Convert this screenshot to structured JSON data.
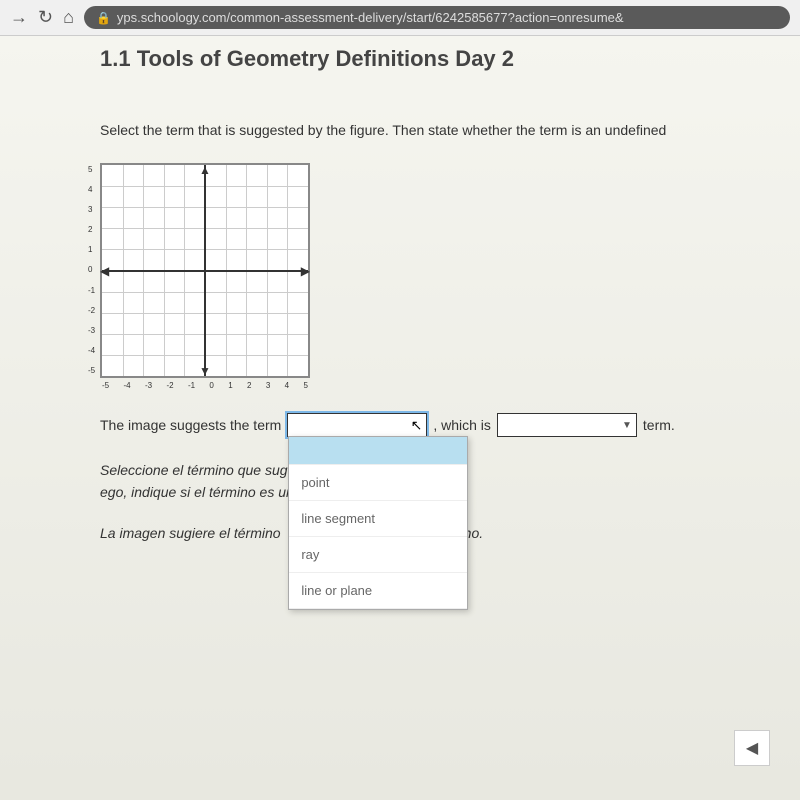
{
  "browser": {
    "url": "yps.schoology.com/common-assessment-delivery/start/6242585677?action=onresume&"
  },
  "page": {
    "title": "1.1 Tools of Geometry Definitions Day 2",
    "question": "Select the term that is suggested by the figure. Then state whether the term is an undefined",
    "sentence1_part1": "The image suggests the term",
    "sentence1_part2": ", which is",
    "sentence1_part3": "term.",
    "sentence2_part1": "Seleccione el término que sug",
    "sentence2_part2": "ego, indique si el término es un término indefin",
    "sentence3_part1": "La imagen sugiere el término",
    "sentence3_part2": "término."
  },
  "dropdown": {
    "options": [
      "",
      "point",
      "line segment",
      "ray",
      "line or plane"
    ]
  },
  "graph": {
    "y_labels": [
      "5",
      "4",
      "3",
      "2",
      "1",
      "0",
      "-1",
      "-2",
      "-3",
      "-4",
      "-5"
    ],
    "x_labels": [
      "-5",
      "-4",
      "-3",
      "-2",
      "-1",
      "0",
      "1",
      "2",
      "3",
      "4",
      "5"
    ]
  }
}
